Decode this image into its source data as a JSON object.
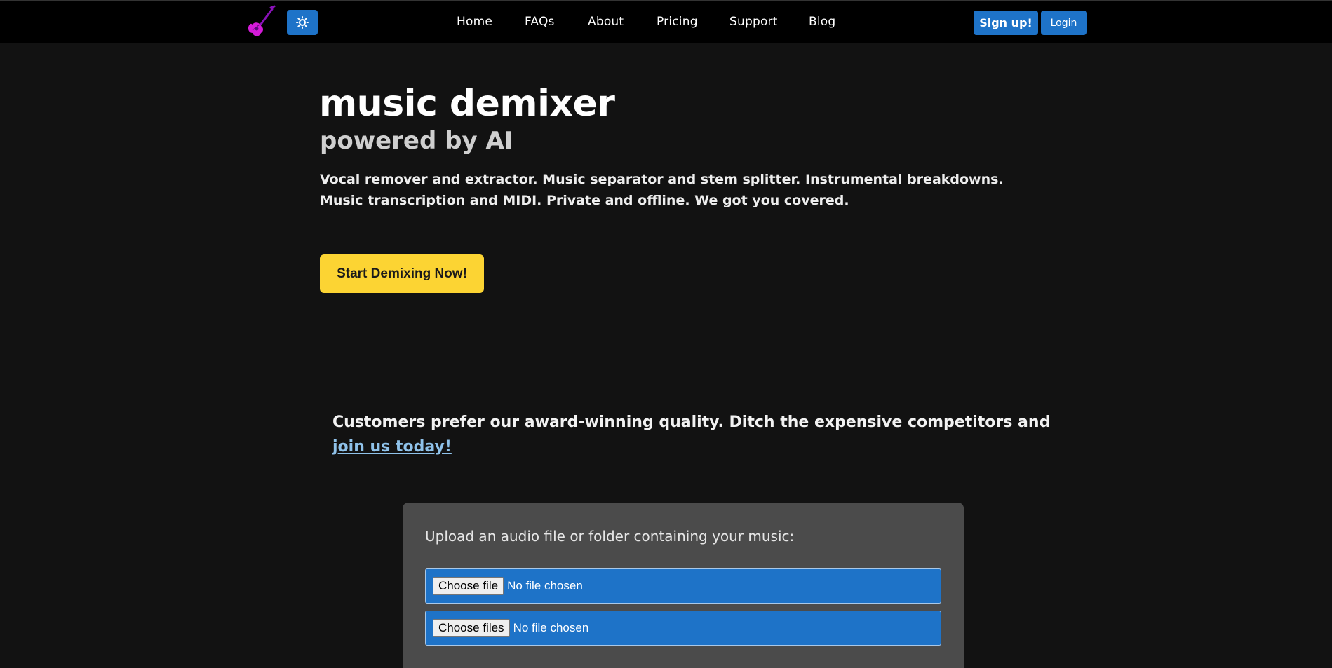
{
  "nav": {
    "links": [
      "Home",
      "FAQs",
      "About",
      "Pricing",
      "Support",
      "Blog"
    ],
    "signup_label": "Sign up!",
    "login_label": "Login",
    "logo_icon": "guitar-icon",
    "theme_icon": "sun-icon"
  },
  "hero": {
    "title": "music demixer",
    "subtitle": "powered by AI",
    "description": "Vocal remover and extractor. Music separator and stem splitter. Instrumental breakdowns. Music transcription and MIDI. Private and offline. We got you covered.",
    "cta_label": "Start Demixing Now!"
  },
  "promo": {
    "text": "Customers prefer our award-winning quality. Ditch the expensive competitors and ",
    "link_label": "join us today!"
  },
  "upload": {
    "label": "Upload an audio file or folder containing your music:",
    "file_button": "Choose file",
    "files_button": "Choose files",
    "file_status": "No file chosen",
    "files_status": "No file chosen"
  },
  "colors": {
    "accent": "#1e73c8",
    "cta": "#fcd433",
    "background": "#121212",
    "link": "#8fc2ea",
    "logo": "#d41bd8"
  }
}
